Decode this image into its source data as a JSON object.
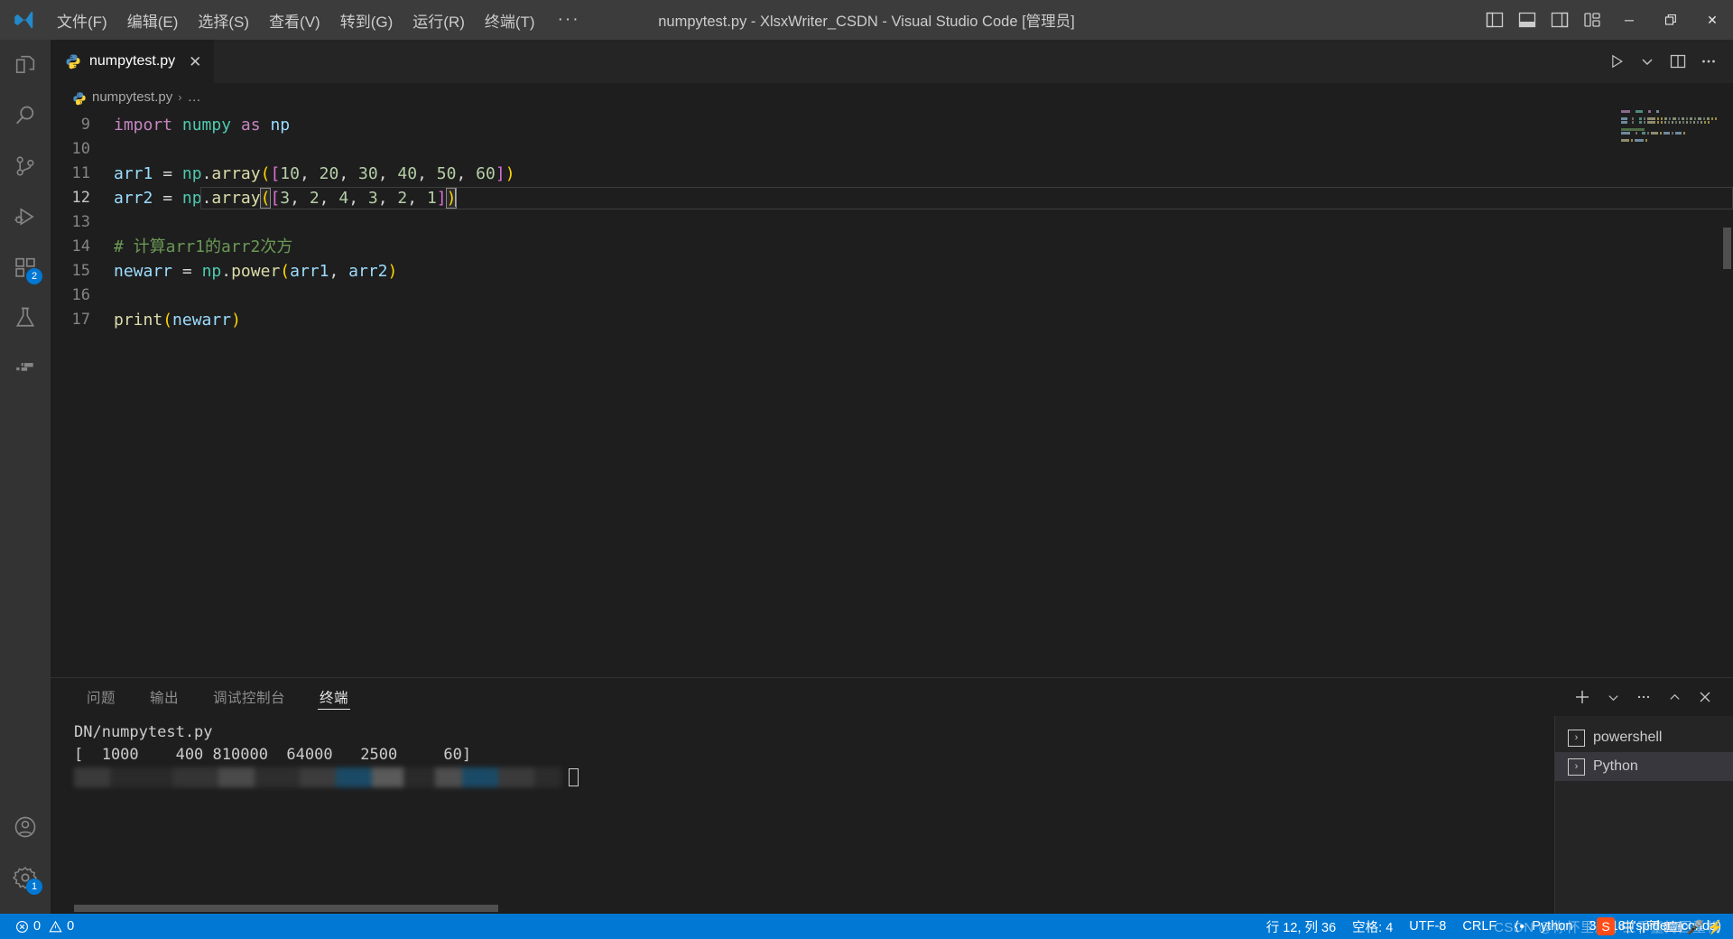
{
  "window": {
    "title": "numpytest.py - XlsxWriter_CSDN - Visual Studio Code [管理员]",
    "logo": "vscode-logo",
    "menu": [
      "文件(F)",
      "编辑(E)",
      "选择(S)",
      "查看(V)",
      "转到(G)",
      "运行(R)",
      "终端(T)"
    ],
    "menu_overflow": "···",
    "layout_buttons": [
      "toggle-primary-sidebar",
      "toggle-panel",
      "toggle-secondary-sidebar",
      "customize-layout"
    ],
    "controls": {
      "minimize": "─",
      "restore": "❐",
      "close": "✕"
    }
  },
  "activitybar": {
    "items": [
      {
        "name": "explorer",
        "icon": "files-icon",
        "badge": ""
      },
      {
        "name": "search",
        "icon": "search-icon",
        "badge": ""
      },
      {
        "name": "source-control",
        "icon": "source-control-icon",
        "badge": ""
      },
      {
        "name": "run-and-debug",
        "icon": "run-debug-icon",
        "badge": ""
      },
      {
        "name": "extensions",
        "icon": "extensions-icon",
        "badge": "2"
      },
      {
        "name": "testing",
        "icon": "beaker-icon",
        "badge": ""
      },
      {
        "name": "remote-explorer",
        "icon": "remote-icon",
        "badge": ""
      }
    ],
    "bottom": [
      {
        "name": "accounts",
        "icon": "account-icon",
        "badge": ""
      },
      {
        "name": "manage",
        "icon": "gear-icon",
        "badge": "1"
      }
    ]
  },
  "tabs": {
    "items": [
      {
        "label": "numpytest.py",
        "icon": "python-icon",
        "close": "✕",
        "active": true
      }
    ],
    "actions": [
      "run-python-file-icon",
      "chevron-down-icon",
      "split-editor-icon",
      "more-actions-icon"
    ]
  },
  "breadcrumb": {
    "icon": "python-icon",
    "file": "numpytest.py",
    "sep": "›",
    "tail": "…"
  },
  "editor": {
    "first_line": 9,
    "lines": [
      {
        "n": 9,
        "tokens": [
          {
            "t": "import",
            "c": "kw"
          },
          {
            "t": " ",
            "c": "op"
          },
          {
            "t": "numpy",
            "c": "mod"
          },
          {
            "t": " ",
            "c": "op"
          },
          {
            "t": "as",
            "c": "kw"
          },
          {
            "t": " ",
            "c": "op"
          },
          {
            "t": "np",
            "c": "var"
          }
        ]
      },
      {
        "n": 10,
        "tokens": []
      },
      {
        "n": 11,
        "tokens": [
          {
            "t": "arr1",
            "c": "var"
          },
          {
            "t": " ",
            "c": "op"
          },
          {
            "t": "=",
            "c": "op"
          },
          {
            "t": " ",
            "c": "op"
          },
          {
            "t": "np",
            "c": "mod"
          },
          {
            "t": ".",
            "c": "op"
          },
          {
            "t": "array",
            "c": "fn"
          },
          {
            "t": "(",
            "c": "br1"
          },
          {
            "t": "[",
            "c": "br2"
          },
          {
            "t": "10",
            "c": "num"
          },
          {
            "t": ", ",
            "c": "op"
          },
          {
            "t": "20",
            "c": "num"
          },
          {
            "t": ", ",
            "c": "op"
          },
          {
            "t": "30",
            "c": "num"
          },
          {
            "t": ", ",
            "c": "op"
          },
          {
            "t": "40",
            "c": "num"
          },
          {
            "t": ", ",
            "c": "op"
          },
          {
            "t": "50",
            "c": "num"
          },
          {
            "t": ", ",
            "c": "op"
          },
          {
            "t": "60",
            "c": "num"
          },
          {
            "t": "]",
            "c": "br2"
          },
          {
            "t": ")",
            "c": "br1"
          }
        ]
      },
      {
        "n": 12,
        "current": true,
        "tokens": [
          {
            "t": "arr2",
            "c": "var"
          },
          {
            "t": " ",
            "c": "op"
          },
          {
            "t": "=",
            "c": "op"
          },
          {
            "t": " ",
            "c": "op"
          },
          {
            "t": "np",
            "c": "mod"
          },
          {
            "t": ".",
            "c": "op"
          },
          {
            "t": "array",
            "c": "fn"
          },
          {
            "t": "(",
            "c": "br1 br-match"
          },
          {
            "t": "[",
            "c": "br2"
          },
          {
            "t": "3",
            "c": "num"
          },
          {
            "t": ", ",
            "c": "op"
          },
          {
            "t": "2",
            "c": "num"
          },
          {
            "t": ", ",
            "c": "op"
          },
          {
            "t": "4",
            "c": "num"
          },
          {
            "t": ", ",
            "c": "op"
          },
          {
            "t": "3",
            "c": "num"
          },
          {
            "t": ", ",
            "c": "op"
          },
          {
            "t": "2",
            "c": "num"
          },
          {
            "t": ", ",
            "c": "op"
          },
          {
            "t": "1",
            "c": "num"
          },
          {
            "t": "]",
            "c": "br2"
          },
          {
            "t": ")",
            "c": "br1 br-match"
          }
        ]
      },
      {
        "n": 13,
        "tokens": []
      },
      {
        "n": 14,
        "tokens": [
          {
            "t": "# 计算arr1的arr2次方",
            "c": "cmt"
          }
        ]
      },
      {
        "n": 15,
        "tokens": [
          {
            "t": "newarr",
            "c": "var"
          },
          {
            "t": " ",
            "c": "op"
          },
          {
            "t": "=",
            "c": "op"
          },
          {
            "t": " ",
            "c": "op"
          },
          {
            "t": "np",
            "c": "mod"
          },
          {
            "t": ".",
            "c": "op"
          },
          {
            "t": "power",
            "c": "fn"
          },
          {
            "t": "(",
            "c": "br1"
          },
          {
            "t": "arr1",
            "c": "var"
          },
          {
            "t": ", ",
            "c": "op"
          },
          {
            "t": "arr2",
            "c": "var"
          },
          {
            "t": ")",
            "c": "br1"
          }
        ]
      },
      {
        "n": 16,
        "tokens": []
      },
      {
        "n": 17,
        "tokens": [
          {
            "t": "print",
            "c": "fn"
          },
          {
            "t": "(",
            "c": "br1"
          },
          {
            "t": "newarr",
            "c": "var"
          },
          {
            "t": ")",
            "c": "br1"
          }
        ]
      }
    ]
  },
  "panel": {
    "tabs": [
      {
        "label": "问题",
        "active": false
      },
      {
        "label": "输出",
        "active": false
      },
      {
        "label": "调试控制台",
        "active": false
      },
      {
        "label": "终端",
        "active": true
      }
    ],
    "actions": [
      "new-terminal-icon",
      "chevron-down-icon",
      "more-actions-icon",
      "maximize-panel-icon",
      "close-panel-icon"
    ],
    "terminal_lines": [
      "DN/numpytest.py",
      "[  1000    400 810000  64000   2500     60]"
    ],
    "terminal_instances": [
      {
        "label": "powershell",
        "icon": "terminal-chevron-icon",
        "active": false
      },
      {
        "label": "Python",
        "icon": "terminal-chevron-icon",
        "active": true
      }
    ]
  },
  "statusbar": {
    "left": [
      {
        "name": "problems",
        "icon": "error-icon",
        "errors": "0",
        "warn_icon": "warning-icon",
        "warnings": "0"
      }
    ],
    "right": [
      {
        "name": "cursor-position",
        "label": "行 12, 列 36"
      },
      {
        "name": "indentation",
        "label": "空格: 4"
      },
      {
        "name": "encoding",
        "label": "UTF-8"
      },
      {
        "name": "eol",
        "label": "CRLF"
      },
      {
        "name": "language-mode",
        "label": "Python",
        "icon": "python-brackets-icon"
      },
      {
        "name": "python-interpreter",
        "label": "3.9.18 ('spider': conda)"
      }
    ]
  },
  "overlays": {
    "watermark": "CSDN @你怀里最小三乖童持回重机",
    "ime": {
      "logo": "S",
      "text": "中 , 罓 ⌨ 🎤 ⚡"
    }
  },
  "colors": {
    "accent": "#0078d4",
    "titlebar_bg": "#3c3c3c",
    "activitybar_bg": "#333333",
    "editor_bg": "#1e1e1e",
    "tab_inactive_bg": "#252526",
    "badge_bg": "#0078d4",
    "comment": "#6a9955",
    "string_number": "#b5cea8",
    "keyword": "#c586c0",
    "function": "#dcdcaa",
    "variable": "#9cdcfe",
    "module": "#4ec9b0",
    "bracket1": "#ffd700",
    "bracket2": "#da70d6"
  }
}
